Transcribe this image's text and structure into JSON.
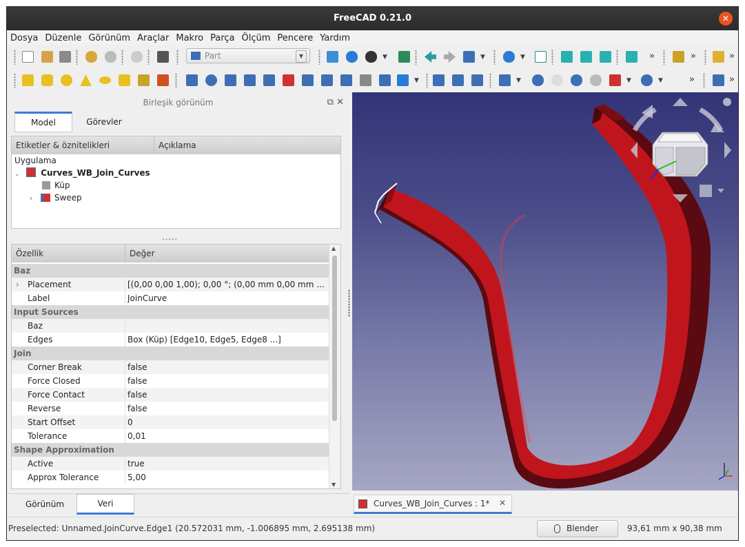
{
  "window": {
    "title": "FreeCAD 0.21.0"
  },
  "menu": [
    "Dosya",
    "Düzenle",
    "Görünüm",
    "Araçlar",
    "Makro",
    "Parça",
    "Ölçüm",
    "Pencere",
    "Yardım"
  ],
  "toolbar": {
    "workbench": "Part",
    "overflow": "»"
  },
  "combo_view": {
    "title": "Birleşik görünüm",
    "tabs": [
      "Model",
      "Görevler"
    ],
    "tree_headers": [
      "Etiketler & öznitelikleri",
      "Açıklama"
    ],
    "tree": {
      "root": "Uygulama",
      "document": "Curves_WB_Join_Curves",
      "items": [
        "Küp",
        "Sweep"
      ]
    },
    "splitter": "-----",
    "property_headers": [
      "Özellik",
      "Değer"
    ],
    "properties": [
      {
        "group": "Baz"
      },
      {
        "name": "Placement",
        "value": "[(0,00 0,00 1,00); 0,00 °; (0,00 mm  0,00 mm ..."
      },
      {
        "name": "Label",
        "value": "JoinCurve"
      },
      {
        "group": "Input Sources"
      },
      {
        "name": "Baz",
        "value": ""
      },
      {
        "name": "Edges",
        "value": "Box (Küp) [Edge10, Edge5, Edge8 ...]"
      },
      {
        "group": "Join"
      },
      {
        "name": "Corner Break",
        "value": "false"
      },
      {
        "name": "Force Closed",
        "value": "false"
      },
      {
        "name": "Force Contact",
        "value": "false"
      },
      {
        "name": "Reverse",
        "value": "false"
      },
      {
        "name": "Start Offset",
        "value": "0"
      },
      {
        "name": "Tolerance",
        "value": "0,01"
      },
      {
        "group": "Shape Approximation"
      },
      {
        "name": "Active",
        "value": "true"
      },
      {
        "name": "Approx Tolerance",
        "value": "5,00"
      }
    ],
    "bottom_tabs": [
      "Görünüm",
      "Veri"
    ],
    "active_bottom_tab": "Veri"
  },
  "document_tab": {
    "label": "Curves_WB_Join_Curves : 1*"
  },
  "status": {
    "preselected": "Preselected: Unnamed.JoinCurve.Edge1 (20.572031 mm, -1.006895 mm, 2.695138 mm)",
    "nav_style": "Blender",
    "dimensions": "93,61 mm x 90,38 mm"
  },
  "colors": {
    "accent": "#3a7bd5",
    "model": "#c0151c",
    "close": "#e95420"
  }
}
